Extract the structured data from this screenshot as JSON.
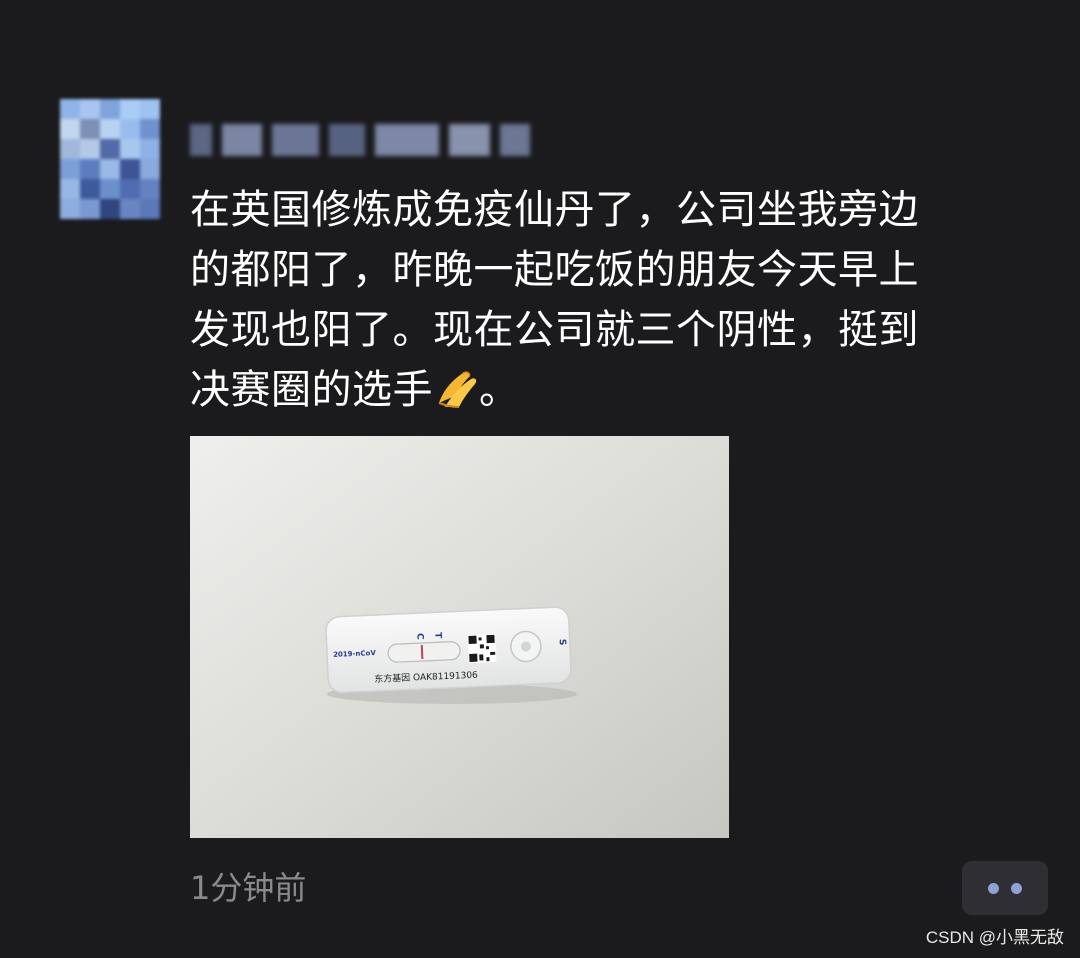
{
  "post": {
    "text_lines": [
      "在英国修炼成免疫仙丹了，公司坐我旁边",
      "的都阳了，昨晚一起吃饭的朋友今天早上",
      "发现也阳了。现在公司就三个阴性，挺到",
      "决赛圈的选手"
    ],
    "text_after_emoji": "。",
    "emoji": "hands-pressed-together-emoji",
    "timestamp": "1分钟前"
  },
  "photo": {
    "device_label": "2019-nCoV",
    "marker_c": "C",
    "marker_t": "T",
    "marker_s": "S",
    "brand_serial": "东方基因 OAK81191306"
  },
  "watermark": "CSDN @小黑无敌",
  "icons": {
    "more": "more-dots-icon"
  },
  "colors": {
    "background": "#1b1b1d",
    "text": "#ffffff",
    "timestamp": "#8a8a8e",
    "more_dots": "#8fa2d6"
  }
}
